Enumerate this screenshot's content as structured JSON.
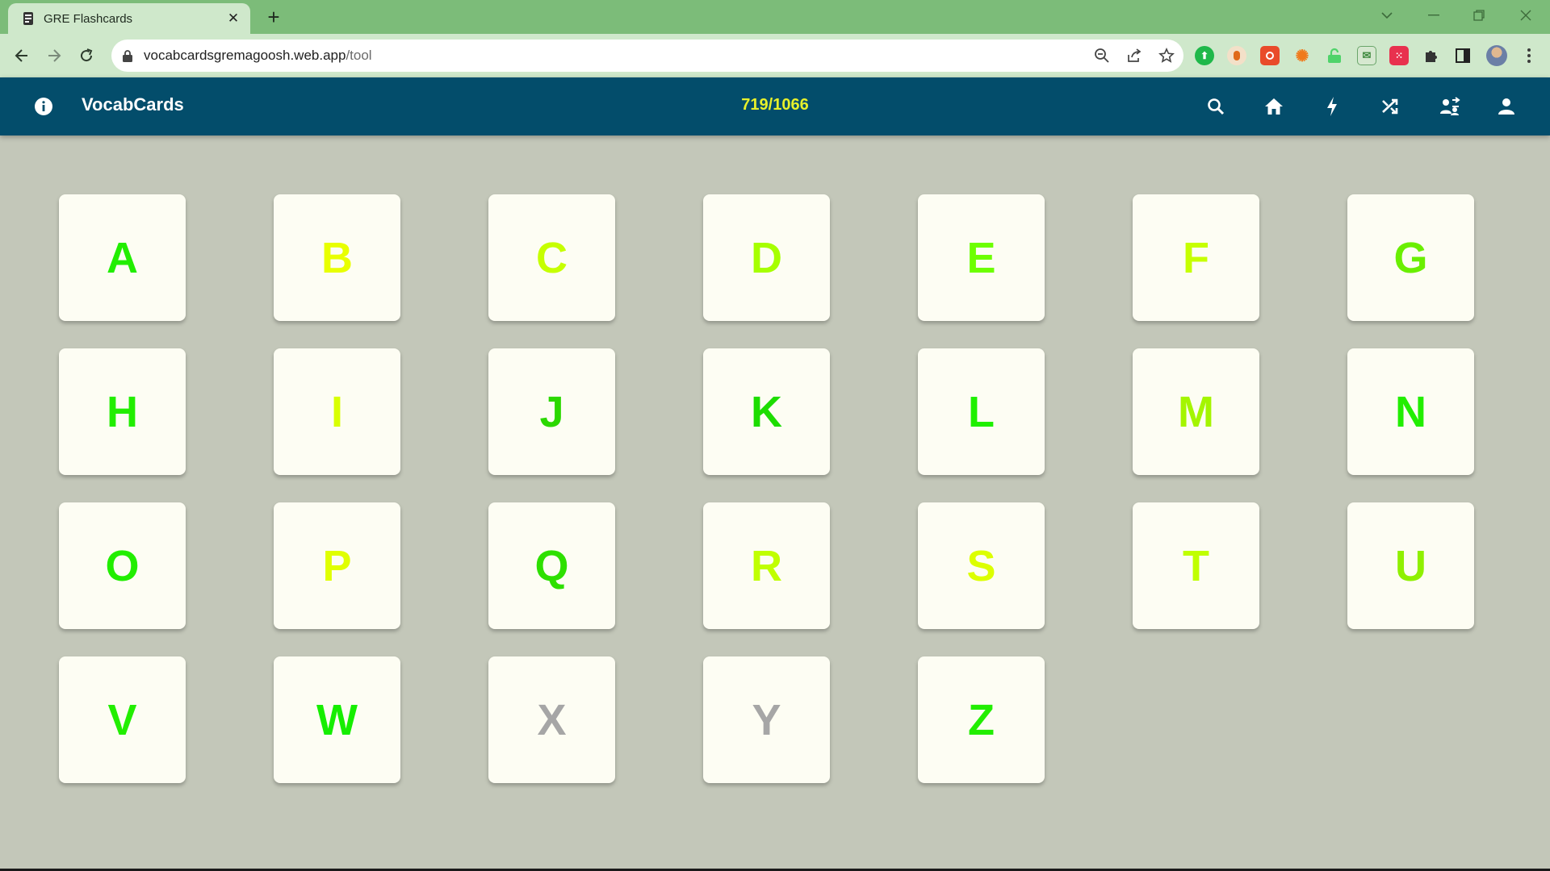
{
  "browser": {
    "tab_title": "GRE Flashcards",
    "url_host": "vocabcardsgremagoosh.web.app",
    "url_path": "/tool"
  },
  "header": {
    "title": "VocabCards",
    "progress": "719/1066"
  },
  "letters": [
    {
      "label": "A",
      "color": "#22ee00"
    },
    {
      "label": "B",
      "color": "#e8ff00"
    },
    {
      "label": "C",
      "color": "#c6ff00"
    },
    {
      "label": "D",
      "color": "#a6ff00"
    },
    {
      "label": "E",
      "color": "#6dff00"
    },
    {
      "label": "F",
      "color": "#c6ff00"
    },
    {
      "label": "G",
      "color": "#6aef00"
    },
    {
      "label": "H",
      "color": "#22ee00"
    },
    {
      "label": "I",
      "color": "#d8ff00"
    },
    {
      "label": "J",
      "color": "#2bd800"
    },
    {
      "label": "K",
      "color": "#1ddd00"
    },
    {
      "label": "L",
      "color": "#1ff000"
    },
    {
      "label": "M",
      "color": "#a4f500"
    },
    {
      "label": "N",
      "color": "#22ee00"
    },
    {
      "label": "O",
      "color": "#22ee00"
    },
    {
      "label": "P",
      "color": "#e0ff00"
    },
    {
      "label": "Q",
      "color": "#2ee000"
    },
    {
      "label": "R",
      "color": "#c0ff00"
    },
    {
      "label": "S",
      "color": "#dcff00"
    },
    {
      "label": "T",
      "color": "#c0ff00"
    },
    {
      "label": "U",
      "color": "#8ff000"
    },
    {
      "label": "V",
      "color": "#22ee00"
    },
    {
      "label": "W",
      "color": "#16ee00"
    },
    {
      "label": "X",
      "color": "#a6a6a6"
    },
    {
      "label": "Y",
      "color": "#a6a6a6"
    },
    {
      "label": "Z",
      "color": "#22ee00"
    }
  ]
}
